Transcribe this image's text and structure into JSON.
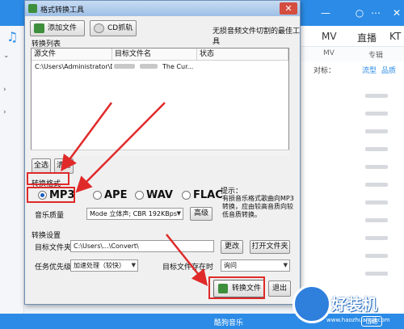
{
  "background_app": {
    "nav_tabs": [
      "MV",
      "直播",
      "KT"
    ],
    "sub_tabs": [
      "MV",
      "专辑"
    ],
    "list_header": {
      "filter_label": "对标：",
      "type_label": "流型",
      "qualifier_label": "品质"
    },
    "bottom_bar": {
      "now_playing": "酷狗音乐",
      "speed_label": "倍速"
    },
    "accent_color": "#2b8be6"
  },
  "dialog": {
    "title": "格式转换工具",
    "tagline": "无损音频文件切割的最佳工具",
    "toolbar": {
      "add_file": "添加文件",
      "cd_rip": "CD抓轨"
    },
    "file_list": {
      "section_title": "转换列表",
      "columns": [
        "源文件",
        "目标文件名",
        "状态"
      ],
      "rows": [
        {
          "source": "C:\\Users\\Administrator\\D...",
          "target": "The Cur..."
        }
      ]
    },
    "list_buttons": {
      "select_all": "全选",
      "clear": "清空"
    },
    "format": {
      "section_title": "转换格式",
      "options": [
        "MP3",
        "APE",
        "WAV",
        "FLAC"
      ],
      "selected": "MP3",
      "quality_label": "音乐质量",
      "quality_value": "Mode 立体声; CBR 192KBps",
      "advanced": "高级",
      "hint_label": "提示：",
      "hint_text": "有损音乐格式歌曲向MP3转换，应由较高音质向较低音质转换。"
    },
    "settings": {
      "section_title": "转换设置",
      "target_folder_label": "目标文件夹",
      "target_folder_value": "C:\\Users\\...\\Convert\\",
      "change": "更改",
      "open_folder": "打开文件夹",
      "priority_label": "任务优先级",
      "priority_value": "加速处理（较快）",
      "exists_label": "目标文件存在时",
      "exists_value": "询问"
    },
    "actions": {
      "convert": "转换文件",
      "exit": "退出"
    }
  },
  "watermark": {
    "text": "好装机",
    "url": "www.haozhuangji.com"
  },
  "annotation_color": "#e02a2a"
}
